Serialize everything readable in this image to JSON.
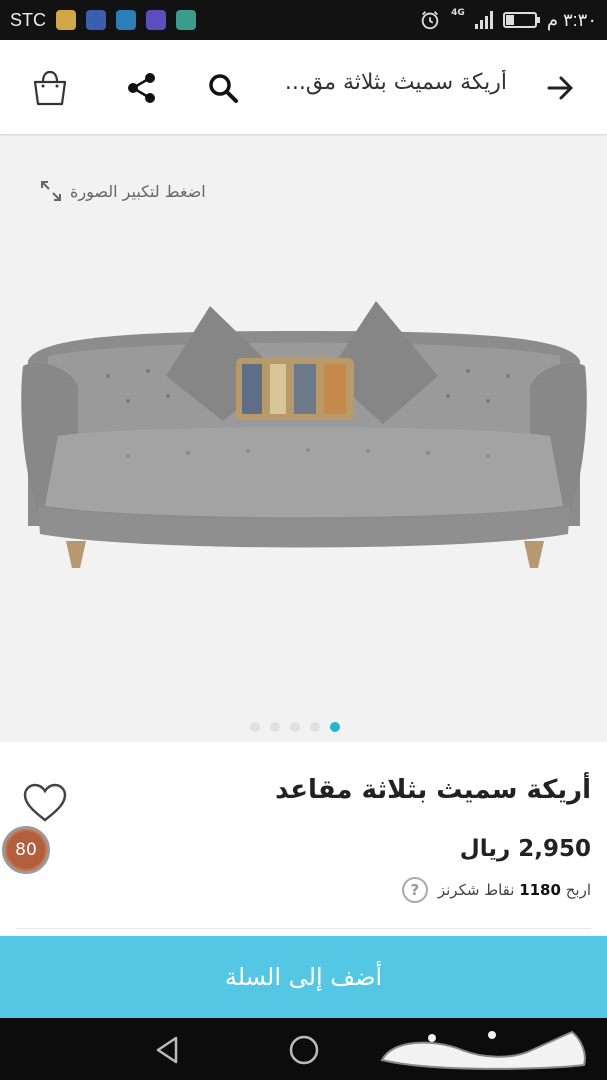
{
  "status_bar": {
    "carrier": "STC",
    "network": "4G",
    "clock": "٣:٣٠ م",
    "battery_level": 0.3,
    "notification_icons": [
      "sim-card-icon",
      "location-app-icon",
      "sim-card-icon",
      "chart-app-icon",
      "gallery-icon"
    ]
  },
  "app_bar": {
    "title": "أريكة سميث بثلاثة مق...",
    "icons": [
      "back-arrow-icon",
      "search-icon",
      "share-icon",
      "shopping-bag-icon"
    ]
  },
  "gallery": {
    "zoom_hint": "اضغط لتكبير الصورة",
    "slide_count": 5,
    "active_slide": 5
  },
  "product": {
    "title": "أريكة سميث بثلاثة مقاعد",
    "price": "2,950 ريال",
    "points_prefix": "اربح",
    "points_value": "1180",
    "points_suffix": "نقاط شكرنز",
    "score": "80"
  },
  "actions": {
    "add_to_cart": "أضف إلى السلة"
  },
  "nav_bar": {
    "watermark": "حراج"
  },
  "colors": {
    "accent": "#53c7e3",
    "active_dot": "#1fb6d1",
    "score_badge": "#c9704b"
  }
}
